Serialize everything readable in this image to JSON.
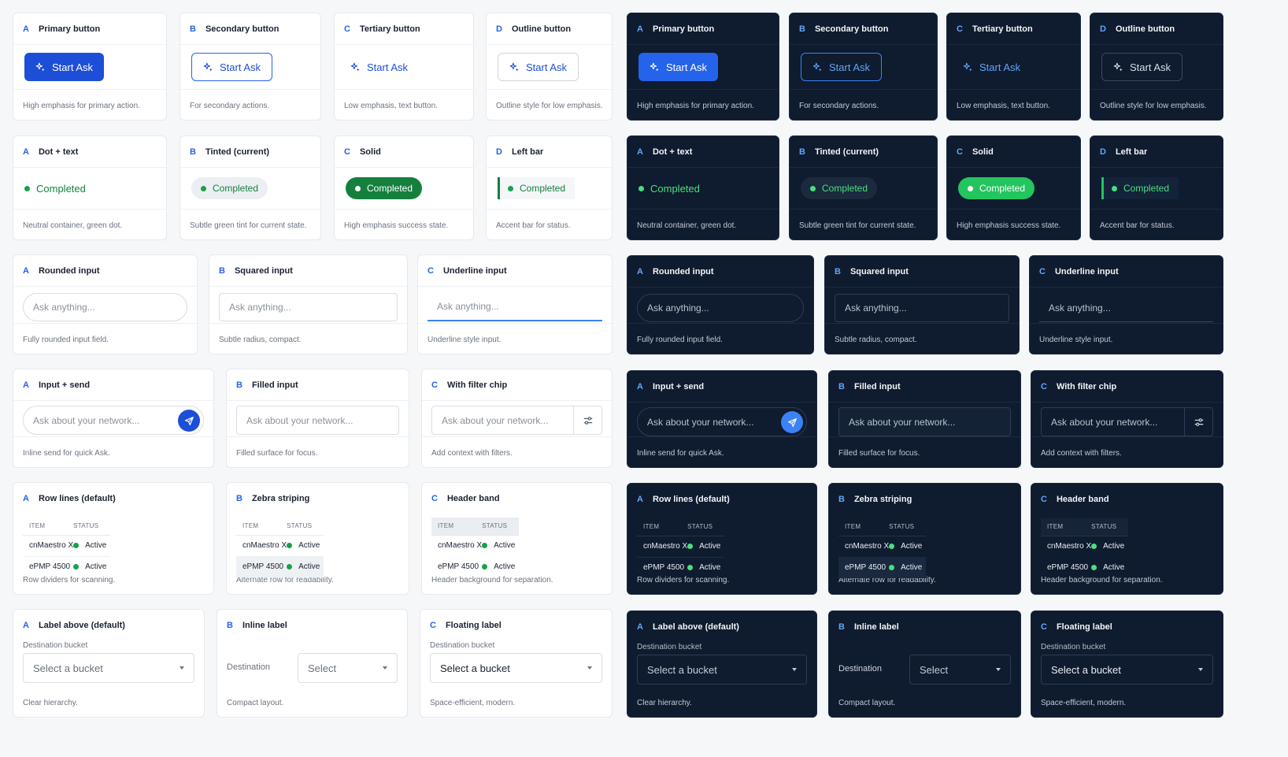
{
  "button_label": "Start Ask",
  "status_label": "Completed",
  "rows": {
    "buttons": [
      {
        "letter": "A",
        "title": "Primary button",
        "desc": "High emphasis for primary action."
      },
      {
        "letter": "B",
        "title": "Secondary button",
        "desc": "For secondary actions."
      },
      {
        "letter": "C",
        "title": "Tertiary button",
        "desc": "Low emphasis, text button."
      },
      {
        "letter": "D",
        "title": "Outline button",
        "desc": "Outline style for low emphasis."
      }
    ],
    "status": [
      {
        "letter": "A",
        "title": "Dot + text",
        "desc": "Neutral container, green dot."
      },
      {
        "letter": "B",
        "title": "Tinted (current)",
        "desc": "Subtle green tint for current state."
      },
      {
        "letter": "C",
        "title": "Solid",
        "desc": "High emphasis success state."
      },
      {
        "letter": "D",
        "title": "Left bar",
        "desc": "Accent bar for status."
      }
    ],
    "inputs": [
      {
        "letter": "A",
        "title": "Rounded input",
        "desc": "Fully rounded input field.",
        "placeholder": "Ask anything..."
      },
      {
        "letter": "B",
        "title": "Squared input",
        "desc": "Subtle radius, compact.",
        "placeholder": "Ask anything..."
      },
      {
        "letter": "C",
        "title": "Underline input",
        "desc": "Underline style input.",
        "placeholder": "Ask anything..."
      }
    ],
    "ask": [
      {
        "letter": "A",
        "title": "Input + send",
        "desc": "Inline send for quick Ask.",
        "placeholder": "Ask about your network..."
      },
      {
        "letter": "B",
        "title": "Filled input",
        "desc": "Filled surface for focus.",
        "placeholder": "Ask about your network..."
      },
      {
        "letter": "C",
        "title": "With filter chip",
        "desc": "Add context with filters.",
        "placeholder": "Ask about your network..."
      }
    ],
    "tables": [
      {
        "letter": "A",
        "title": "Row lines (default)",
        "desc": "Row dividers for scanning."
      },
      {
        "letter": "B",
        "title": "Zebra striping",
        "desc": "Alternate row for readability."
      },
      {
        "letter": "C",
        "title": "Header band",
        "desc": "Header background for separation."
      }
    ],
    "labels": [
      {
        "letter": "A",
        "title": "Label above (default)",
        "desc": "Clear hierarchy.",
        "label": "Destination bucket",
        "value": "Select a bucket"
      },
      {
        "letter": "B",
        "title": "Inline label",
        "desc": "Compact layout.",
        "label": "Destination",
        "value": "Select"
      },
      {
        "letter": "C",
        "title": "Floating label",
        "desc": "Space-efficient, modern.",
        "label": "Destination bucket",
        "value": "Select a bucket"
      }
    ]
  },
  "table": {
    "headers": [
      "ITEM",
      "STATUS"
    ],
    "rows": [
      {
        "item": "cnMaestro X",
        "status": "Active"
      },
      {
        "item": "ePMP 4500",
        "status": "Active"
      }
    ]
  },
  "icons": {
    "button": "sparkle-icon",
    "send": "send-icon",
    "filter": "sliders-icon",
    "caret": "chevron-down-icon"
  },
  "colors": {
    "primary": "#1d4ed8",
    "success": "#15803d",
    "dark_surface": "#0f1b2e",
    "light_surface": "#ffffff"
  }
}
